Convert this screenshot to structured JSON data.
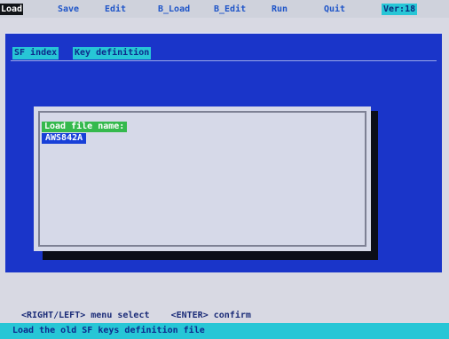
{
  "menu": {
    "items": [
      {
        "label": "Load",
        "active": true
      },
      {
        "label": "Save"
      },
      {
        "label": "Edit"
      },
      {
        "label": "B_Load"
      },
      {
        "label": "B_Edit"
      },
      {
        "label": "Run"
      },
      {
        "label": "Quit"
      }
    ],
    "version": "Ver:18"
  },
  "tabs": [
    "SF index",
    "Key definition"
  ],
  "dialog": {
    "label": "Load file name:",
    "value": "AWS842A"
  },
  "hint": "<RIGHT/LEFT> menu select    <ENTER> confirm",
  "status": "Load the old SF keys definition file",
  "colors": {
    "desktop": "#d8d9e3",
    "window_blue": "#1a35c9",
    "cyan": "#27c6d6",
    "label_green": "#35b94d",
    "input_blue": "#1840d8"
  }
}
